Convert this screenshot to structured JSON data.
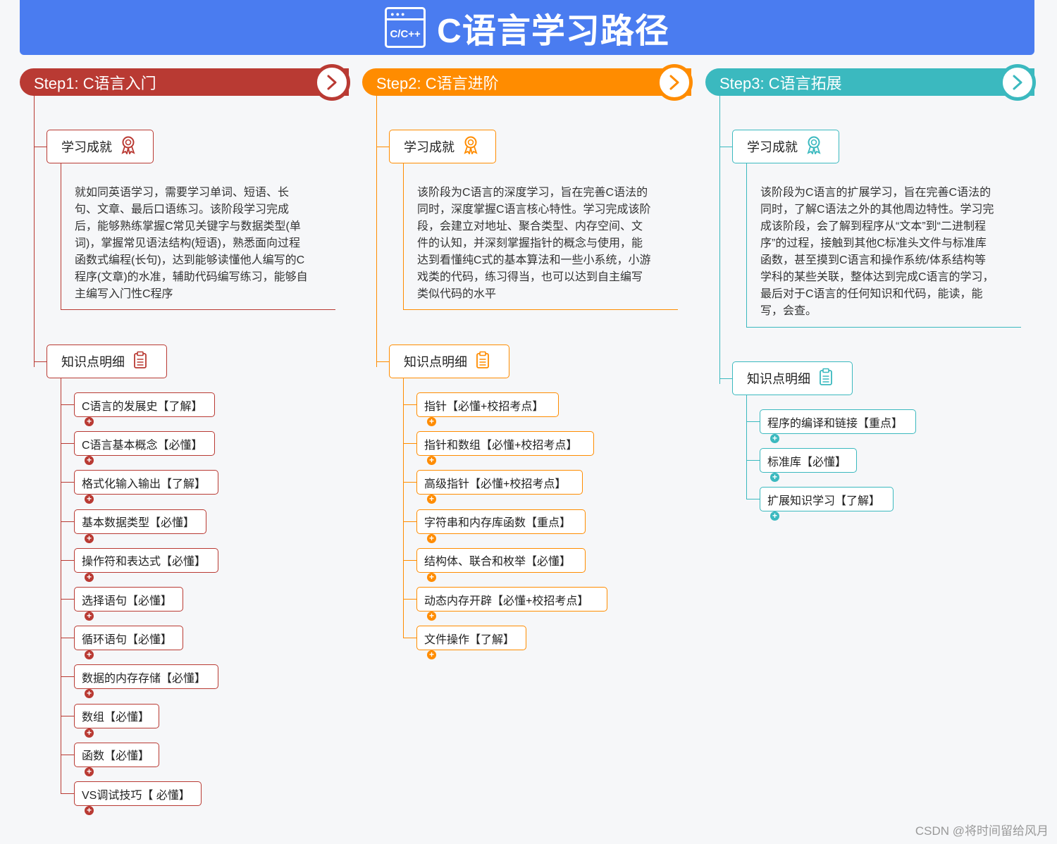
{
  "header": {
    "icon_text": "C/C++",
    "title": "C语言学习路径"
  },
  "steps": [
    {
      "title": "Step1: C语言入门",
      "color": "#b93a33",
      "achievement_label": "学习成就",
      "knowledge_label": "知识点明细",
      "description": [
        "就如同英语学习，需要学习单词、短语、长",
        "句、文章、最后口语练习。该阶段学习完成",
        "后，能够熟练掌握C常见关键字与数据类型(单",
        "词)，掌握常见语法结构(短语)，熟悉面向过程",
        "函数式编程(长句)，达到能够读懂他人编写的C",
        "程序(文章)的水准，辅助代码编写练习，能够自",
        "主编写入门性C程序"
      ],
      "items": [
        "C语言的发展史【了解】",
        "C语言基本概念【必懂】",
        "格式化输入输出【了解】",
        "基本数据类型【必懂】",
        "操作符和表达式【必懂】",
        "选择语句【必懂】",
        "循环语句【必懂】",
        "数据的内存存储【必懂】",
        "数组【必懂】",
        "函数【必懂】",
        "VS调试技巧【 必懂】"
      ]
    },
    {
      "title": "Step2: C语言进阶",
      "color": "#ff8c00",
      "achievement_label": "学习成就",
      "knowledge_label": "知识点明细",
      "description": [
        "该阶段为C语言的深度学习，旨在完善C语法的",
        "同时，深度掌握C语言核心特性。学习完成该阶",
        "段，会建立对地址、聚合类型、内存空间、文",
        "件的认知，并深刻掌握指针的概念与使用，能",
        "达到看懂纯C式的基本算法和一些小系统，小游",
        "戏类的代码，练习得当，也可以达到自主编写",
        "类似代码的水平"
      ],
      "items": [
        "指针【必懂+校招考点】",
        "指针和数组【必懂+校招考点】",
        "高级指针【必懂+校招考点】",
        "字符串和内存库函数【重点】",
        "结构体、联合和枚举【必懂】",
        "动态内存开辟【必懂+校招考点】",
        "文件操作【了解】"
      ]
    },
    {
      "title": "Step3: C语言拓展",
      "color": "#3bb9bf",
      "achievement_label": "学习成就",
      "knowledge_label": "知识点明细",
      "description": [
        "该阶段为C语言的扩展学习，旨在完善C语法的",
        "同时，了解C语法之外的其他周边特性。学习完",
        "成该阶段，会了解到程序从“文本”到“二进制程",
        "序”的过程，接触到其他C标准头文件与标准库",
        "函数，甚至摸到C语言和操作系统/体系结构等",
        "学科的某些关联，整体达到完成C语言的学习，",
        "最后对于C语言的任何知识和代码，能读，能",
        "写，会查。"
      ],
      "items": [
        "程序的编译和链接【重点】",
        "标准库【必懂】",
        "扩展知识学习【了解】"
      ]
    }
  ],
  "watermark": "CSDN @将时间留给风月"
}
